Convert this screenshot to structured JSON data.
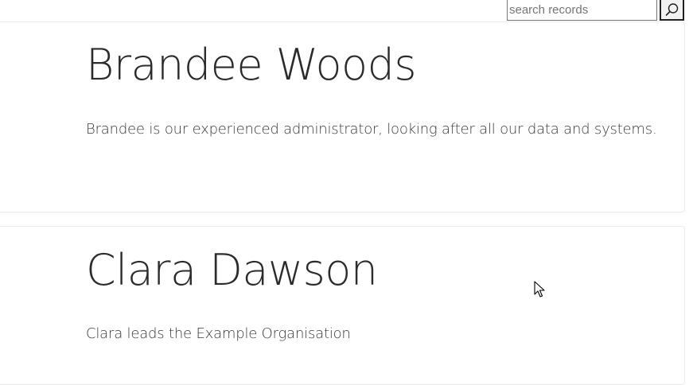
{
  "search": {
    "placeholder": "search records",
    "value": "",
    "button_icon": "search-icon"
  },
  "records": [
    {
      "name": "Brandee Woods",
      "description": "Brandee is our experienced administrator, looking after all our data and systems."
    },
    {
      "name": "Clara Dawson",
      "description": "Clara leads the Example Organisation"
    }
  ],
  "colors": {
    "text": "#2b2b2b",
    "card_border": "#ececec",
    "background": "#ffffff"
  }
}
